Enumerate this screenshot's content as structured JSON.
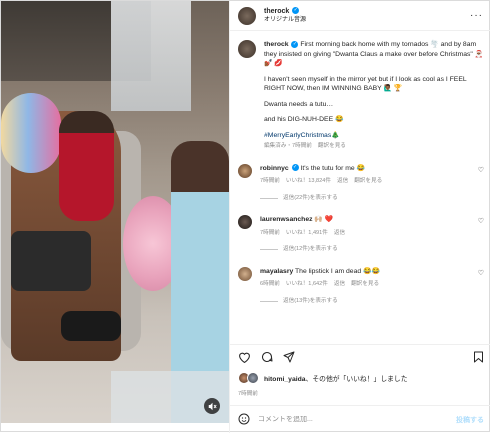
{
  "header": {
    "username": "therock",
    "audio": "オリジナル音源"
  },
  "caption": {
    "username": "therock",
    "text1": "First morning back home with my tornados 🌪️ and by 8am they insisted on giving \"Dwanta Claus a make over before Christmas\" 🎅🏾 💅🏾 💋",
    "text2": "I haven't seen myself in the mirror yet but if I look as cool as I FEEL RIGHT NOW, then IM WINNING BABY 🙋🏾‍♂️ 🏆",
    "text3": "Dwanta needs a tutu…",
    "text4": "and his DIG-NUH-DEE 😂",
    "hashtag": "#MerryEarlyChristmas🎄",
    "edited": "編集済み",
    "time": "7時間前",
    "translate": "翻訳を見る"
  },
  "comments": [
    {
      "username": "robinnyc",
      "text": "It's the tutu for me 😂",
      "time": "7時間前",
      "likes": "いいね！13,824件",
      "reply": "返信",
      "translate": "翻訳を見る",
      "replies": "返信(22件)を表示する"
    },
    {
      "username": "laurenwsanchez",
      "text": "🙌🏼 ❤️",
      "time": "7時間前",
      "likes": "いいね！1,491件",
      "reply": "返信",
      "translate": "",
      "replies": "返信(12件)を表示する"
    },
    {
      "username": "mayalasry",
      "text": "The lipstick I am dead 😂😂",
      "time": "6時間前",
      "likes": "いいね！1,642件",
      "reply": "返信",
      "translate": "翻訳を見る",
      "replies": "返信(13件)を表示する"
    }
  ],
  "likes": {
    "user": "hitomi_yaida",
    "text": "、その他が「いいね！」しました"
  },
  "post_time": "7時間前",
  "add_comment": {
    "placeholder": "コメントを追加...",
    "post_label": "投稿する"
  },
  "colors": {
    "verified": "#0095f6",
    "link": "#00376b",
    "muted": "#8e8e8e",
    "post_button": "#b2dffc"
  }
}
